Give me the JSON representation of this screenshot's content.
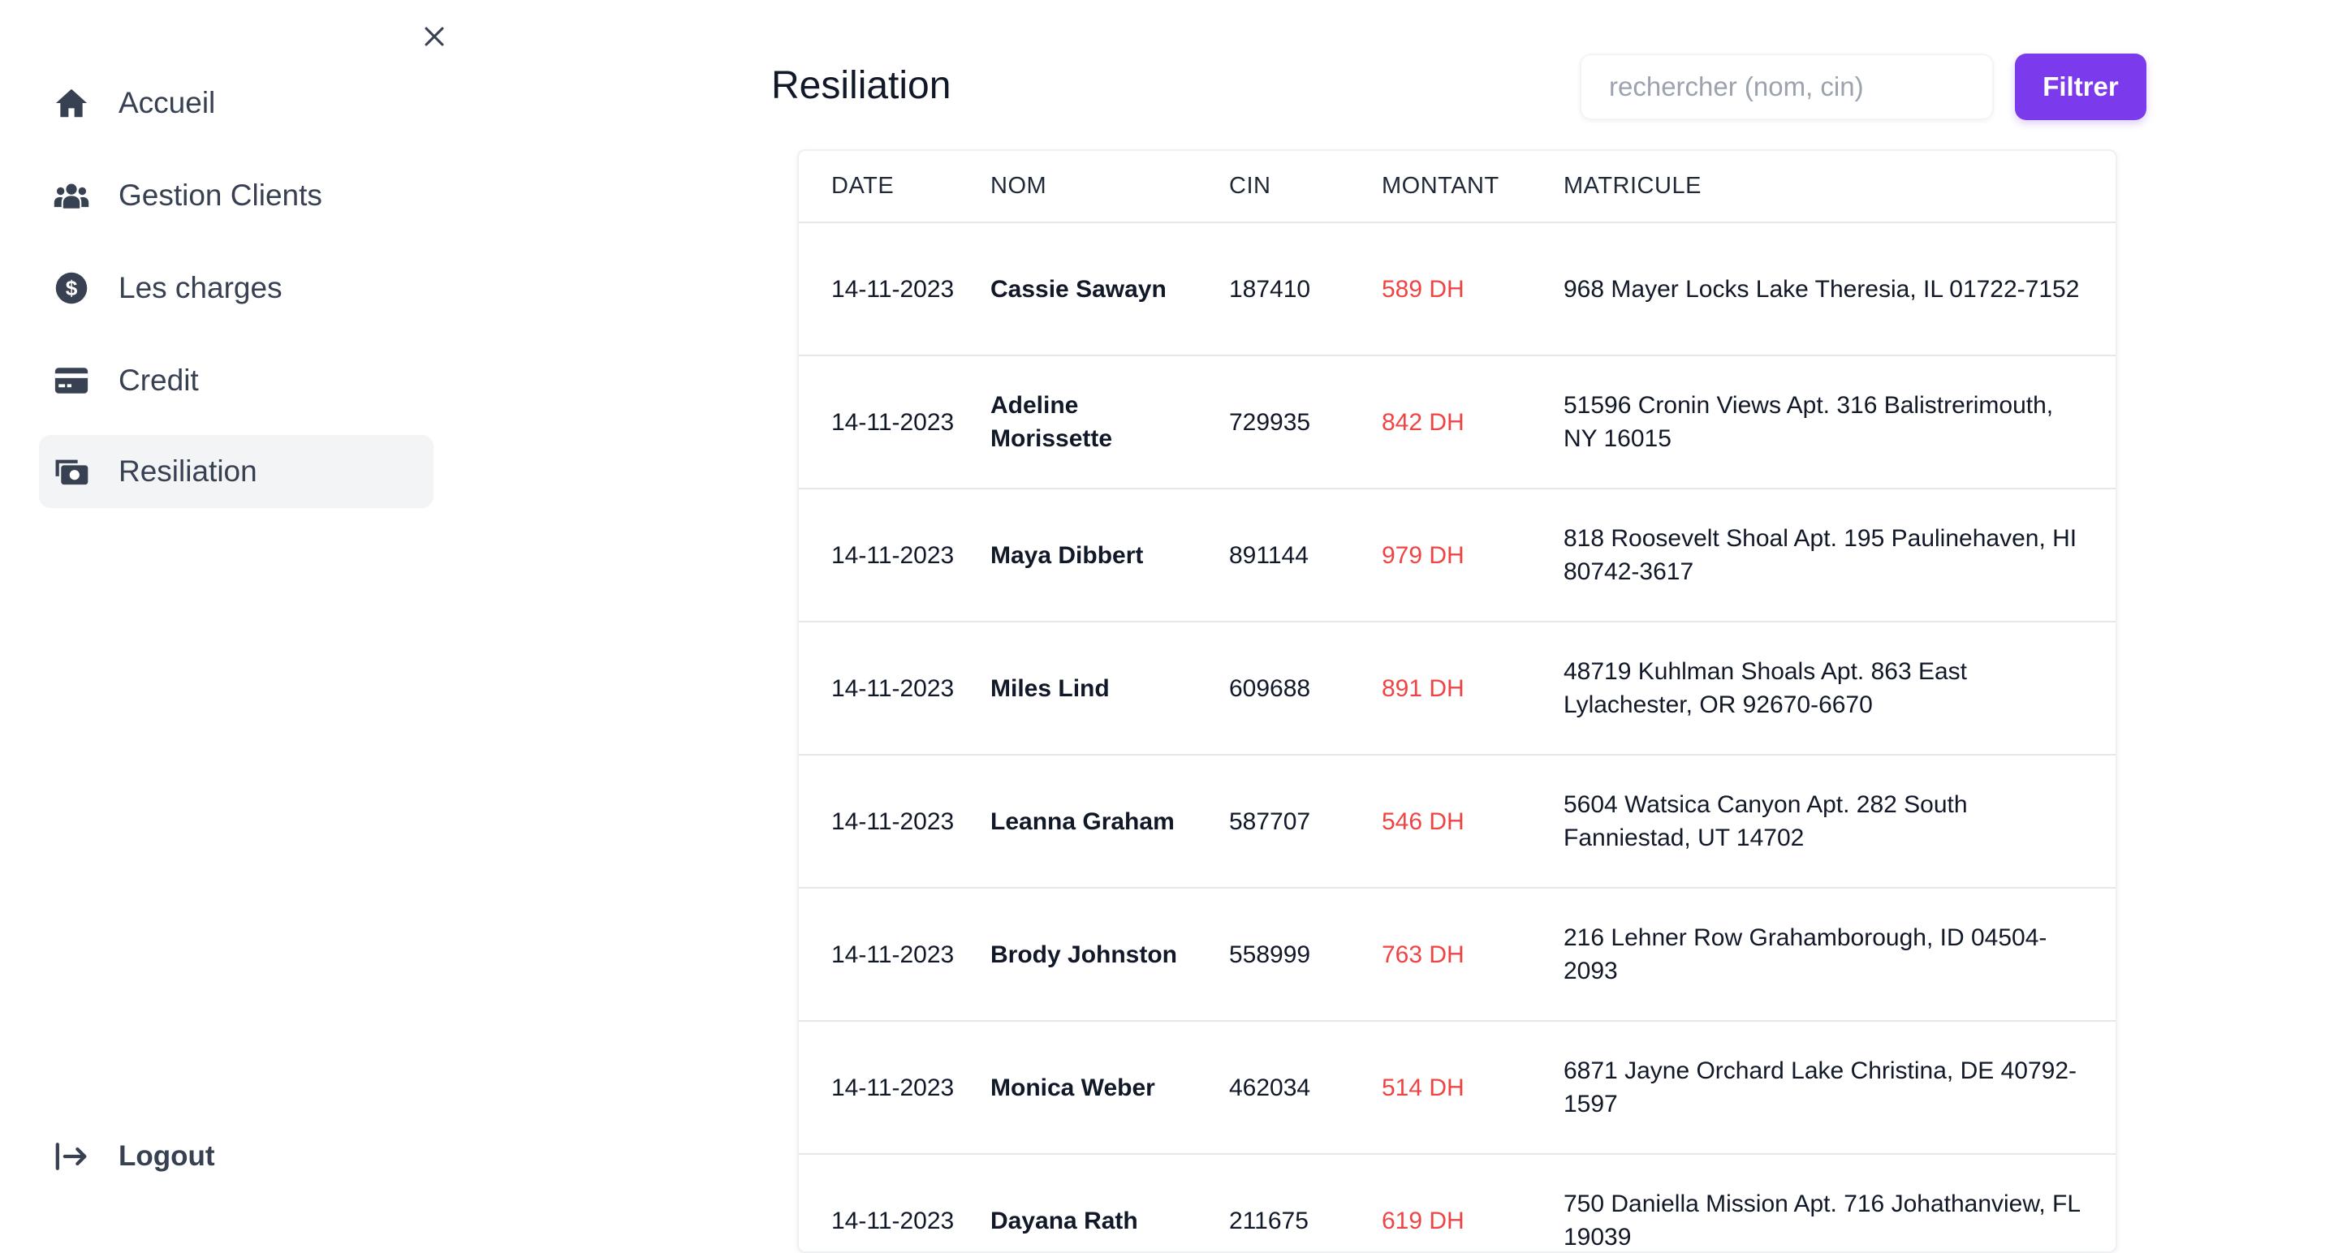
{
  "sidebar": {
    "items": [
      {
        "label": "Accueil",
        "icon": "home-icon",
        "active": false
      },
      {
        "label": "Gestion Clients",
        "icon": "users-icon",
        "active": false
      },
      {
        "label": "Les charges",
        "icon": "dollar-circle-icon",
        "active": false
      },
      {
        "label": "Credit",
        "icon": "credit-card-icon",
        "active": false
      },
      {
        "label": "Resiliation",
        "icon": "money-stack-icon",
        "active": true
      }
    ],
    "logout_label": "Logout"
  },
  "main": {
    "title": "Resiliation",
    "search": {
      "placeholder": "rechercher (nom, cin)",
      "value": ""
    },
    "filter_label": "Filtrer",
    "table": {
      "headers": {
        "date": "DATE",
        "nom": "NOM",
        "cin": "CIN",
        "montant": "MONTANT",
        "matricule": "MATRICULE"
      },
      "rows": [
        {
          "date": "14-11-2023",
          "nom": "Cassie Sawayn",
          "cin": "187410",
          "montant": "589 DH",
          "matricule": "968 Mayer Locks Lake Theresia, IL 01722-7152"
        },
        {
          "date": "14-11-2023",
          "nom": "Adeline Morissette",
          "cin": "729935",
          "montant": "842 DH",
          "matricule": "51596 Cronin Views Apt. 316 Balistrerimouth, NY 16015"
        },
        {
          "date": "14-11-2023",
          "nom": "Maya Dibbert",
          "cin": "891144",
          "montant": "979 DH",
          "matricule": "818 Roosevelt Shoal Apt. 195 Paulinehaven, HI 80742-3617"
        },
        {
          "date": "14-11-2023",
          "nom": "Miles Lind",
          "cin": "609688",
          "montant": "891 DH",
          "matricule": "48719 Kuhlman Shoals Apt. 863 East Lylachester, OR 92670-6670"
        },
        {
          "date": "14-11-2023",
          "nom": "Leanna Graham",
          "cin": "587707",
          "montant": "546 DH",
          "matricule": "5604 Watsica Canyon Apt. 282 South Fanniestad, UT 14702"
        },
        {
          "date": "14-11-2023",
          "nom": "Brody Johnston",
          "cin": "558999",
          "montant": "763 DH",
          "matricule": "216 Lehner Row Grahamborough, ID 04504-2093"
        },
        {
          "date": "14-11-2023",
          "nom": "Monica Weber",
          "cin": "462034",
          "montant": "514 DH",
          "matricule": "6871 Jayne Orchard Lake Christina, DE 40792-1597"
        },
        {
          "date": "14-11-2023",
          "nom": "Dayana Rath",
          "cin": "211675",
          "montant": "619 DH",
          "matricule": "750 Daniella Mission Apt. 716 Johathanview, FL 19039"
        }
      ]
    }
  },
  "colors": {
    "accent": "#7c3aed",
    "amount": "#ef4444",
    "active_bg": "#f3f4f6"
  }
}
